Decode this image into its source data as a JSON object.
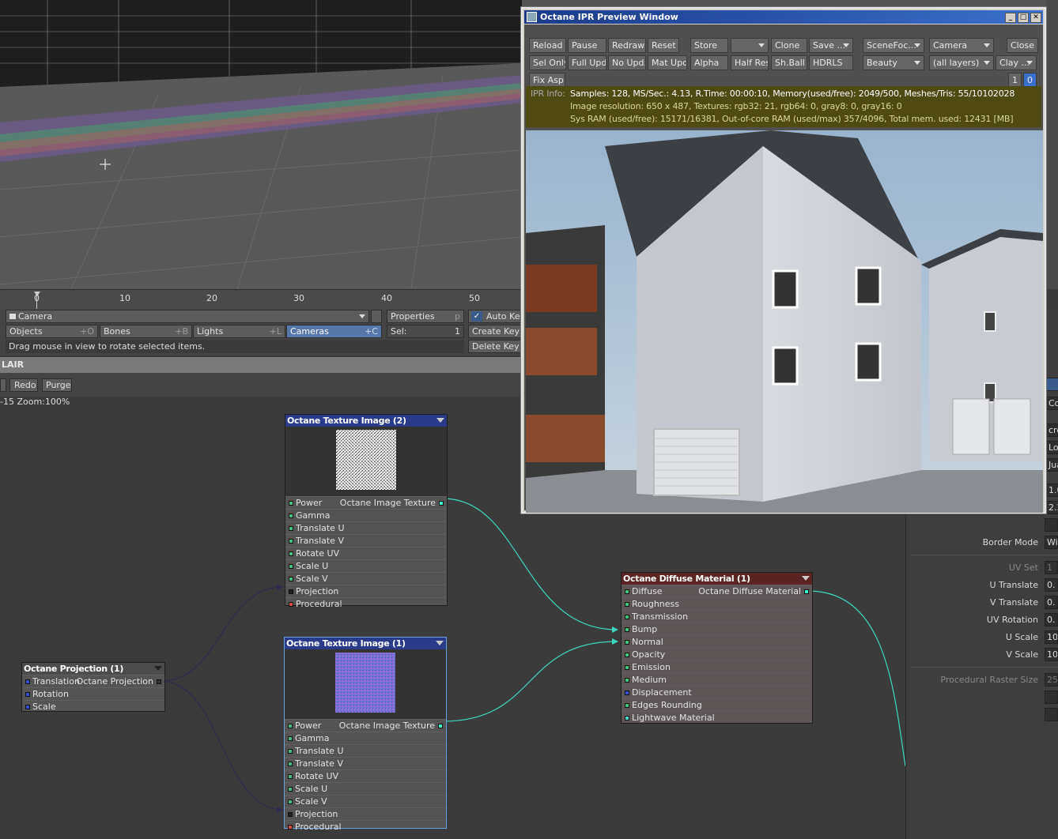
{
  "ipr": {
    "title": "Octane IPR Preview Window",
    "row1": [
      "Reload",
      "Pause",
      "Redraw",
      "Reset",
      "Store",
      "",
      "Clone",
      "Save ...",
      "SceneFoc...",
      "Camera",
      "Close"
    ],
    "row2": [
      "Sel Only",
      "Full Upd.",
      "No Upd.",
      "Mat Upd",
      "Alpha",
      "Half Res",
      "Sh.Ball",
      "HDRLS",
      "Beauty",
      "(all layers)",
      "Clay ..."
    ],
    "fixasp": "Fix Asp.",
    "page1": "1",
    "page2": "0",
    "info_label": "IPR Info:",
    "info_line1": "Samples: 128, MS/Sec.: 4.13, R.Time: 00:00:10, Memory(used/free): 2049/500, Meshes/Tris: 55/10102028",
    "info_line2": "Image resolution: 650 x 487, Textures:  rgb32: 21, rgb64: 0, gray8: 0, gray16: 0",
    "info_line3": "Sys RAM (used/free): 15171/16381, Out-of-core RAM (used/max) 357/4096, Total mem. used: 12431  [MB]"
  },
  "timeline": {
    "ticks": [
      "0",
      "10",
      "20",
      "30",
      "40",
      "50"
    ]
  },
  "lwbar": {
    "camera": "Camera",
    "properties": "Properties",
    "properties_sc": "p",
    "autokey": "Auto Key",
    "objects": "Objects",
    "objects_sc": "+O",
    "bones": "Bones",
    "bones_sc": "+B",
    "lights": "Lights",
    "lights_sc": "+L",
    "cameras": "Cameras",
    "cameras_sc": "+C",
    "sel": "Sel:",
    "sel_val": "1",
    "createkey": "Create Key",
    "deletekey": "Delete Key",
    "status": "Drag mouse in view to rotate selected items."
  },
  "lair": {
    "title": "LAIR",
    "redo": "Redo",
    "purge": "Purge",
    "zoom": "-15 Zoom:100%"
  },
  "nodes": {
    "tex2": {
      "title": "Octane Texture Image (2)",
      "output": "Octane Image Texture",
      "inputs": [
        "Power",
        "Gamma",
        "Translate U",
        "Translate V",
        "Rotate UV",
        "Scale U",
        "Scale V",
        "Projection",
        "Procedural"
      ]
    },
    "tex1": {
      "title": "Octane Texture Image (1)",
      "output": "Octane Image Texture",
      "inputs": [
        "Power",
        "Gamma",
        "Translate U",
        "Translate V",
        "Rotate UV",
        "Scale U",
        "Scale V",
        "Projection",
        "Procedural"
      ]
    },
    "proj": {
      "title": "Octane Projection (1)",
      "output": "Octane Projection",
      "inputs": [
        "Translation",
        "Rotation",
        "Scale"
      ]
    },
    "diff": {
      "title": "Octane Diffuse Material (1)",
      "output": "Octane Diffuse Material",
      "inputs": [
        "Diffuse",
        "Roughness",
        "Transmission",
        "Bump",
        "Normal",
        "Opacity",
        "Emission",
        "Medium",
        "Displacement",
        "Edges Rounding",
        "Lightwave Material"
      ]
    }
  },
  "rpanel": {
    "border_mode": "Border Mode",
    "border_mode_val": "Wi",
    "uv_set": "UV Set",
    "uv_set_val": "1",
    "u_translate": "U Translate",
    "u_translate_val": "0.",
    "v_translate": "V Translate",
    "v_translate_val": "0.",
    "uv_rotation": "UV Rotation",
    "uv_rotation_val": "0.",
    "u_scale": "U Scale",
    "u_scale_val": "10",
    "v_scale": "V Scale",
    "v_scale_val": "10",
    "procedural_raster": "Procedural Raster Size",
    "procedural_raster_val": "25",
    "side_cut": [
      "Co",
      "cre",
      "Lo",
      "Jua",
      "1.0",
      "2.2"
    ]
  },
  "colors": {
    "accent": "#5578a8",
    "info_bg": "#4e4a12",
    "wire": "#3fd8c0"
  }
}
